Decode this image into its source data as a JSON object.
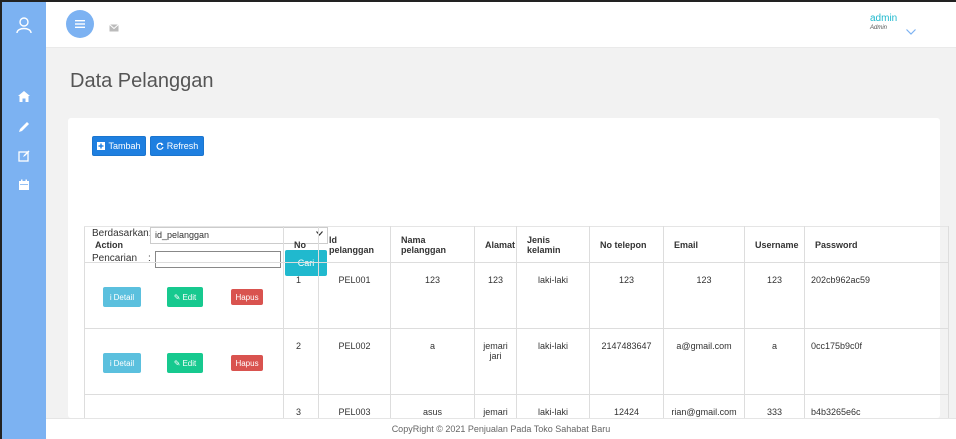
{
  "topbar": {
    "admin_name": "admin",
    "admin_role": "Admin"
  },
  "page": {
    "title": "Data Pelanggan"
  },
  "toolbar": {
    "add_label": "Tambah",
    "refresh_label": "Refresh"
  },
  "filter": {
    "by_label": "Berdasarkan:",
    "by_value": "id_pelanggan",
    "search_label": "Pencarian",
    "search_value": "",
    "search_button": "Cari"
  },
  "table": {
    "headers": [
      "Action",
      "No",
      "Id pelanggan",
      "Nama pelanggan",
      "Alamat",
      "Jenis kelamin",
      "No telepon",
      "Email",
      "Username",
      "Password"
    ],
    "action_labels": {
      "detail": "Detail",
      "edit": "Edit",
      "delete": "Hapus"
    },
    "rows": [
      {
        "no": "1",
        "id": "PEL001",
        "nama": "123",
        "alamat": "123",
        "jk": "laki-laki",
        "telp": "123",
        "email": "123",
        "username": "123",
        "password": "202cb962ac59"
      },
      {
        "no": "2",
        "id": "PEL002",
        "nama": "a",
        "alamat": "jemari jari",
        "jk": "laki-laki",
        "telp": "2147483647",
        "email": "a@gmail.com",
        "username": "a",
        "password": "0cc175b9c0f"
      },
      {
        "no": "3",
        "id": "PEL003",
        "nama": "asus",
        "alamat": "jemari",
        "jk": "laki-laki",
        "telp": "12424",
        "email": "rian@gmail.com",
        "username": "333",
        "password": "b4b3265e6c"
      }
    ]
  },
  "footer": {
    "text": "CopyRight © 2021 Penjualan Pada Toko Sahabat Baru"
  }
}
